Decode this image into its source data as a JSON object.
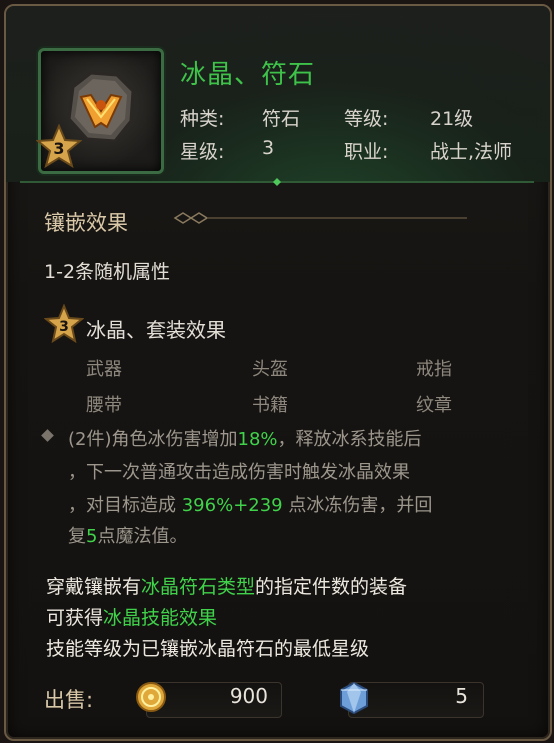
{
  "item": {
    "name": "冰晶、符石",
    "type_label": "种类:",
    "type_value": "符石",
    "level_label": "等级:",
    "level_value": "21级",
    "star_label": "星级:",
    "star_value": "3",
    "class_label": "职业:",
    "class_value": "战士,法师",
    "icon": "rune-stone-icon",
    "star_badge": "3"
  },
  "inlay": {
    "title": "镶嵌效果",
    "random_attr": "1-2条随机属性"
  },
  "set": {
    "star_badge": "3",
    "title": "冰晶、套装效果",
    "slots": [
      "武器",
      "头盔",
      "戒指",
      "腰带",
      "书籍",
      "纹章"
    ],
    "bonus": {
      "l1_a": "(2件)角色冰伤害增加",
      "l1_b": "18%",
      "l1_c": "，释放冰系技能后",
      "l2": "，下一次普通攻击造成伤害时触发冰晶效果",
      "l3_a": "，对目标造成 ",
      "l3_b": "396%+239",
      "l3_c": " 点冰冻伤害，并回",
      "l4_a": "复",
      "l4_b": "5",
      "l4_c": "点魔法值。"
    }
  },
  "notes": {
    "line1_a": "穿戴镶嵌有",
    "line1_b": "冰晶符石类型",
    "line1_c": "的指定件数的装备",
    "line2_a": "可获得",
    "line2_b": "冰晶技能效果",
    "line3": "技能等级为已镶嵌冰晶符石的最低星级"
  },
  "sell": {
    "label": "出售:",
    "gold": "900",
    "gold_icon": "gold-coin-icon",
    "gem": "5",
    "gem_icon": "blue-diamond-icon"
  },
  "colors": {
    "accent_green": "#3fd24a",
    "border_gold": "#6a5a44"
  }
}
